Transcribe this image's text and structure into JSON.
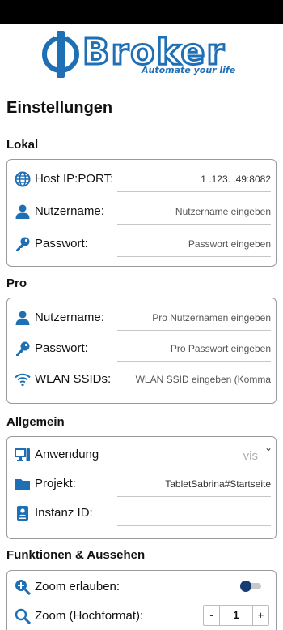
{
  "colors": {
    "accent": "#1f6fb5",
    "toggle_knob": "#173c74"
  },
  "brand": {
    "name": "Broker",
    "tagline": "Automate your life"
  },
  "page_title": "Einstellungen",
  "lokal": {
    "title": "Lokal",
    "host": {
      "label": "Host IP:PORT:",
      "value": "1   .123.  .49:8082",
      "icon": "globe-icon"
    },
    "user": {
      "label": "Nutzername:",
      "placeholder": "Nutzername eingeben",
      "icon": "person-icon"
    },
    "password": {
      "label": "Passwort:",
      "placeholder": "Passwort eingeben",
      "icon": "key-icon"
    }
  },
  "pro": {
    "title": "Pro",
    "user": {
      "label": "Nutzername:",
      "placeholder": "Pro Nutzernamen eingeben",
      "icon": "person-icon"
    },
    "password": {
      "label": "Passwort:",
      "placeholder": "Pro Passwort eingeben",
      "icon": "key-icon"
    },
    "wlan": {
      "label": "WLAN SSIDs:",
      "placeholder": "WLAN SSID eingeben (Komma",
      "icon": "wifi-icon"
    }
  },
  "allgemein": {
    "title": "Allgemein",
    "app": {
      "label": "Anwendung",
      "selected": "vis",
      "icon": "app-icon"
    },
    "project": {
      "label": "Projekt:",
      "value": "TabletSabrina#Startseite",
      "icon": "folder-icon"
    },
    "instance": {
      "label": "Instanz ID:",
      "value": "",
      "icon": "id-card-icon"
    }
  },
  "funktionen": {
    "title": "Funktionen & Aussehen",
    "zoom_allow": {
      "label": "Zoom erlauben:",
      "enabled": false,
      "icon": "zoom-plus-icon"
    },
    "zoom_portrait": {
      "label": "Zoom (Hochformat):",
      "value": "1",
      "minus": "-",
      "plus": "+",
      "icon": "search-icon"
    }
  }
}
